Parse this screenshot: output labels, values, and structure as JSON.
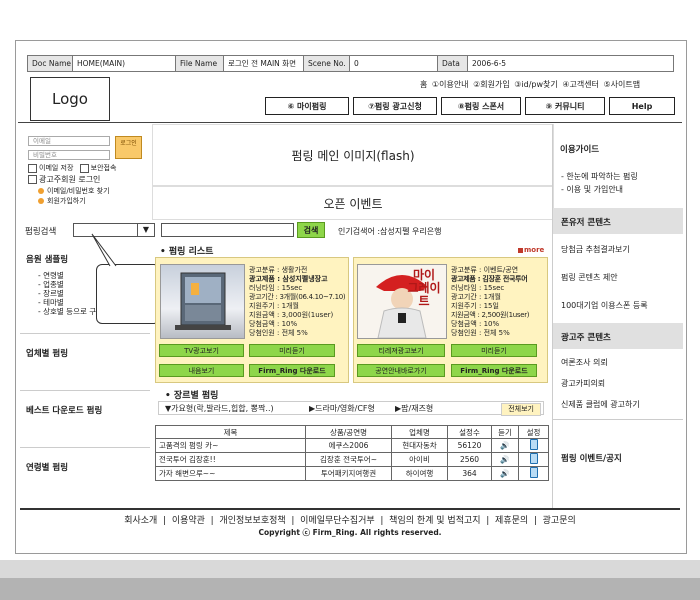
{
  "docbar": {
    "doc_name_label": "Doc Name",
    "doc_name_value": "HOME(MAIN)",
    "file_name_label": "File  Name",
    "file_name_value": "로그인 전 MAIN 화면",
    "scene_label": "Scene No.",
    "scene_value": "0",
    "data_label": "Data",
    "data_value": "2006-6-5"
  },
  "logo": "Logo",
  "top_links": [
    "홈",
    "①이용안내",
    "②회원가입",
    "③id/pw찾기",
    "④고객센터",
    "⑤사이트맵"
  ],
  "nav": [
    "⑥ 마이펌링",
    "⑦펌링 광고신청",
    "⑧펌링 스폰서",
    "⑨ 커뮤니티",
    "Help"
  ],
  "login": {
    "id_placeholder": "이메일",
    "pw_placeholder": "비밀번호",
    "login_button": "로그인",
    "save_email": "이메일 저장",
    "secure": "보안접속",
    "advertiser_login": "광고주회원 로그인",
    "find_link": "이메일/비밀번호 찾기",
    "join_link": "회원가입하기"
  },
  "main_image": "펌링 메인 이미지(flash)",
  "open_event": "오픈 이벤트",
  "search": {
    "label": "펌링검색",
    "button": "검색",
    "popular": "인기검색어 :삼성지펠 우리은행"
  },
  "left_sections": {
    "sound_sample": "음원 샘플링",
    "sound_items": [
      "- 연령별",
      "- 업종별",
      "- 장르별",
      "- 테마별",
      "- 상호별 등으로 구분"
    ],
    "industry": "업체별 펌링",
    "best": "베스트 다운로드 펌링",
    "age": "연령별 펌링"
  },
  "list": {
    "title": "펌링 리스트",
    "more": "more",
    "item1": {
      "lines": [
        "광고분류 : 생활가전",
        "광고제품 : 삼성지펠냉장고",
        "러닝타임 : 15sec",
        "광고기간 : 3개월(06.4.10~7.10)",
        "지원주기 : 1개월",
        "지원금액 : 3,000원(1user)",
        "당첨금액 : 10%",
        "당첨인원 : 전체 5%"
      ],
      "btn_tv": "TV광고보기",
      "btn_preview": "미리듣기",
      "btn_mine": "내음보기",
      "btn_download": "Firm_Ring 다운로드"
    },
    "item2": {
      "lines": [
        "광고분류 : 이벤트/공연",
        "광고제품 : 김장훈 전국투어",
        "러닝타임 : 15sec",
        "광고기간 : 1개월",
        "지원주기 : 15일",
        "지원금액 : 2,500원(1user)",
        "당첨금액 : 10%",
        "당첨인원 : 전체 5%"
      ],
      "poster_text": "마이 그레이트",
      "btn_tv": "티레져광고보기",
      "btn_preview": "미리듣기",
      "btn_mine": "공연안내바로가기",
      "btn_download": "Firm_Ring 다운로드"
    }
  },
  "genre": {
    "title": "장르별 펌링",
    "cat1": "▼가요형(락,발라드,힙합, 뽕짝..)",
    "cat2": "▶드라마/영화/CF형",
    "cat3": "▶팝/재즈형",
    "all": "전체보기"
  },
  "table": {
    "headers": [
      "제목",
      "상품/공연명",
      "업체명",
      "설정수",
      "듣기",
      "설정"
    ],
    "rows": [
      [
        "고품격의 펌링 카~",
        "에쿠스2006",
        "현대자동차",
        "56120"
      ],
      [
        "전국투어 김장훈!!",
        "김장훈 전국투어~",
        "아이비",
        "2560"
      ],
      [
        "가자 해변으루~~",
        "투어패키지여행권",
        "하이여행",
        "364"
      ]
    ]
  },
  "right": {
    "guide_title": "이용가이드",
    "guide_items": [
      "- 한눈에 파악하는 펌링",
      "- 이용 및 가입안내"
    ],
    "user_title": "폰유저 콘텐츠",
    "user_items": [
      "당첨금 추첨결과보기",
      "펌링 콘텐츠 제안",
      "100대기업 이용스폰 등록"
    ],
    "adv_title": "광고주 콘텐츠",
    "adv_items": [
      "여론조사 의뢰",
      "광고카피의뢰",
      "신제품 클럽에 광고하기"
    ],
    "event_title": "펌링 이벤트/공지"
  },
  "footer": {
    "links": [
      "회사소개",
      "이용약관",
      "개인정보보호정책",
      "이메일무단수집거부",
      "책임의 한계 및 법적고지",
      "제휴문의",
      "광고문의"
    ],
    "copyright": "Copyright ⓒ Firm_Ring. All rights reserved."
  }
}
